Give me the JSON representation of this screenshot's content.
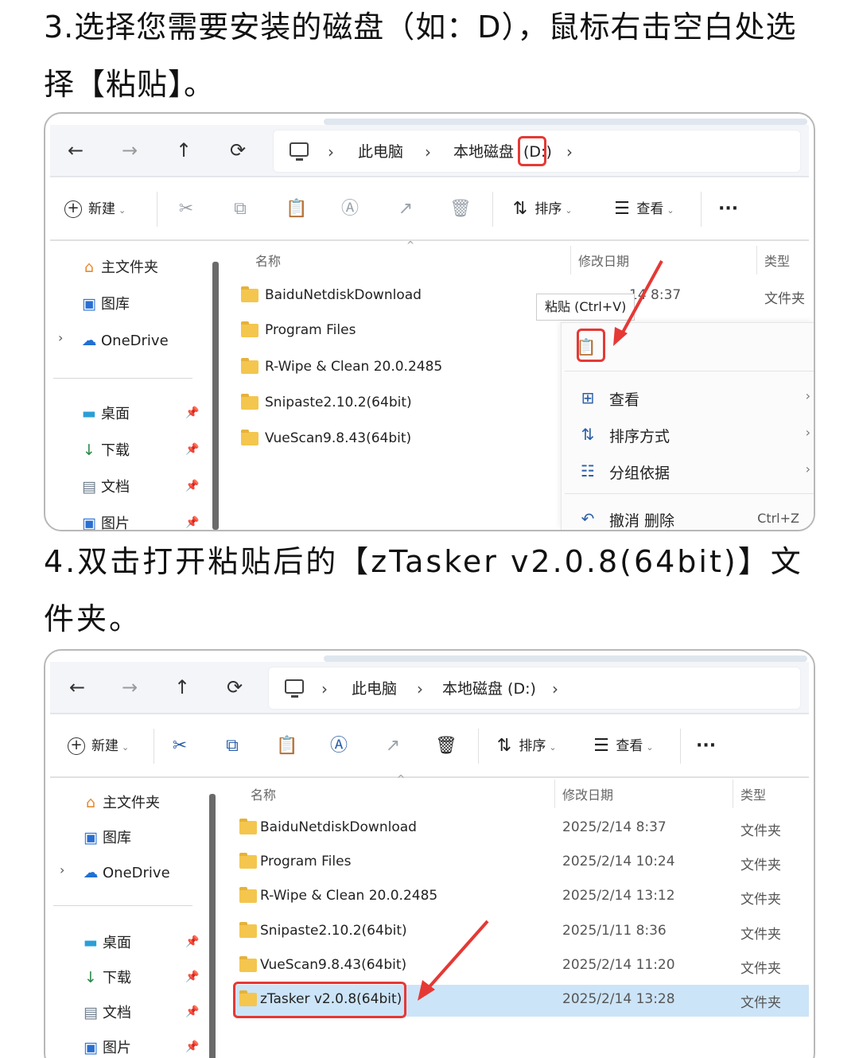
{
  "step3": "3.选择您需要安装的磁盘（如：D），鼠标右击空白处选择【粘贴】。",
  "step4": "4.双击打开粘贴后的【zTasker v2.0.8(64bit)】文件夹。",
  "nav": {
    "back": "←",
    "forward": "→",
    "up": "↑",
    "refresh": "⟳",
    "sep": "›",
    "this_pc": "此电脑",
    "drive": "本地磁盘",
    "drive_letter": "(D:)",
    "drive_full": "本地磁盘 (D:)"
  },
  "toolbar": {
    "new": "新建",
    "sort": "排序",
    "view": "查看",
    "more": "···"
  },
  "sidebar": {
    "home": "主文件夹",
    "gallery": "图库",
    "onedrive": "OneDrive",
    "desktop": "桌面",
    "downloads": "下载",
    "documents": "文档",
    "pictures": "图片",
    "expand": "›"
  },
  "columns": {
    "name": "名称",
    "date": "修改日期",
    "type": "类型",
    "sort_caret": "^"
  },
  "files1": [
    {
      "name": "BaiduNetdiskDownload"
    },
    {
      "name": "Program Files"
    },
    {
      "name": "R-Wipe & Clean 20.0.2485"
    },
    {
      "name": "Snipaste2.10.2(64bit)"
    },
    {
      "name": "VueScan9.8.43(64bit)"
    }
  ],
  "files1_first_date": "14 8:37",
  "files1_first_type": "文件夹",
  "context_menu": {
    "tooltip": "粘贴 (Ctrl+V)",
    "view": "查看",
    "sort_by": "排序方式",
    "group_by": "分组依据",
    "undo": "撤消 删除",
    "undo_shortcut": "Ctrl+Z",
    "submenu": "›"
  },
  "files2": [
    {
      "name": "BaiduNetdiskDownload",
      "date": "2025/2/14 8:37",
      "type": "文件夹"
    },
    {
      "name": "Program Files",
      "date": "2025/2/14 10:24",
      "type": "文件夹"
    },
    {
      "name": "R-Wipe & Clean 20.0.2485",
      "date": "2025/2/14 13:12",
      "type": "文件夹"
    },
    {
      "name": "Snipaste2.10.2(64bit)",
      "date": "2025/1/11 8:36",
      "type": "文件夹"
    },
    {
      "name": "VueScan9.8.43(64bit)",
      "date": "2025/2/14 11:20",
      "type": "文件夹"
    },
    {
      "name": "zTasker v2.0.8(64bit)",
      "date": "2025/2/14 13:28",
      "type": "文件夹"
    }
  ],
  "colors": {
    "highlight": "#e53935",
    "selection": "#cce4f7",
    "folder": "#f4c64e",
    "accent": "#2a5fa8"
  }
}
